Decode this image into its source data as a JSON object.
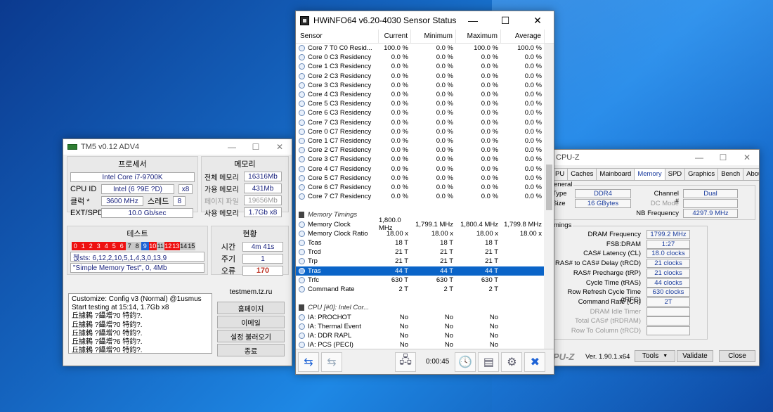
{
  "tm5": {
    "title": "TM5 v0.12 ADV4",
    "cpu_header": "프로세서",
    "cpu_name": "Intel Core i7-9700K",
    "cpu_id_label": "CPU ID",
    "cpu_id_value": "Intel (6 ?9E ?D)",
    "cpu_id_mult": "x8",
    "clock_label": "클럭 *",
    "clock_value": "3600 MHz",
    "threads_label": "스레드",
    "threads_value": "8",
    "ext_label": "EXT/SPD",
    "ext_value": "10.0 Gb/sec",
    "mem_header": "메모리",
    "mem_total_label": "전체 메모리",
    "mem_total_value": "16316Mb",
    "mem_avail_label": "가용 메모리",
    "mem_avail_value": "431Mb",
    "mem_page_label": "페이지 파일",
    "mem_page_value": "19656Mb",
    "mem_used_label": "사용 메모리",
    "mem_used_value": "1.7Gb x8",
    "test_header": "테스트",
    "test_cells": [
      "0",
      "1",
      "2",
      "3",
      "4",
      "5",
      "6",
      "7",
      "8",
      "9",
      "10",
      "11",
      "12",
      "13",
      "14",
      "15"
    ],
    "tests_line": "첹sts: 6,12,2,10,5,1,4,3,0,13,9",
    "config_line": "\"Simple Memory Test\", 0, 4Mb",
    "status_header": "현황",
    "time_label": "시간",
    "time_value": "4m 41s",
    "cycle_label": "주기",
    "cycle_value": "1",
    "error_label": "오류",
    "error_value": "170",
    "log_lines": [
      "Customize: Config v3 (Normal) @1usmus",
      "Start testing at 15:14, 1.7Gb x8",
      "丘據鶫 ?鑷增?0 特鈞?.",
      "丘據鶫 ?鑷增?0 特鈞?.",
      "丘據鶫 ?鑷增?0 特鈞?.",
      "丘據鶫 ?鑷增?6 特鈞?.",
      "丘據鶫 ?鑷增?0 特鈞?."
    ],
    "site": "testmem.tz.ru",
    "btn_home": "홈페이지",
    "btn_email": "이메일",
    "btn_load": "설정 불러오기",
    "btn_exit": "종료"
  },
  "hwinfo": {
    "title": "HWiNFO64 v6.20-4030 Sensor Status",
    "col_sensor": "Sensor",
    "col_current": "Current",
    "col_min": "Minimum",
    "col_max": "Maximum",
    "col_avg": "Average",
    "rows": [
      {
        "name": "Core 7 T0 C0 Resid...",
        "cur": "100.0 %",
        "min": "0.0 %",
        "max": "100.0 %",
        "avg": "100.0 %"
      },
      {
        "name": "Core 0 C3 Residency",
        "cur": "0.0 %",
        "min": "0.0 %",
        "max": "0.0 %",
        "avg": "0.0 %"
      },
      {
        "name": "Core 1 C3 Residency",
        "cur": "0.0 %",
        "min": "0.0 %",
        "max": "0.0 %",
        "avg": "0.0 %"
      },
      {
        "name": "Core 2 C3 Residency",
        "cur": "0.0 %",
        "min": "0.0 %",
        "max": "0.0 %",
        "avg": "0.0 %"
      },
      {
        "name": "Core 3 C3 Residency",
        "cur": "0.0 %",
        "min": "0.0 %",
        "max": "0.0 %",
        "avg": "0.0 %"
      },
      {
        "name": "Core 4 C3 Residency",
        "cur": "0.0 %",
        "min": "0.0 %",
        "max": "0.0 %",
        "avg": "0.0 %"
      },
      {
        "name": "Core 5 C3 Residency",
        "cur": "0.0 %",
        "min": "0.0 %",
        "max": "0.0 %",
        "avg": "0.0 %"
      },
      {
        "name": "Core 6 C3 Residency",
        "cur": "0.0 %",
        "min": "0.0 %",
        "max": "0.0 %",
        "avg": "0.0 %"
      },
      {
        "name": "Core 7 C3 Residency",
        "cur": "0.0 %",
        "min": "0.0 %",
        "max": "0.0 %",
        "avg": "0.0 %"
      },
      {
        "name": "Core 0 C7 Residency",
        "cur": "0.0 %",
        "min": "0.0 %",
        "max": "0.0 %",
        "avg": "0.0 %"
      },
      {
        "name": "Core 1 C7 Residency",
        "cur": "0.0 %",
        "min": "0.0 %",
        "max": "0.0 %",
        "avg": "0.0 %"
      },
      {
        "name": "Core 2 C7 Residency",
        "cur": "0.0 %",
        "min": "0.0 %",
        "max": "0.0 %",
        "avg": "0.0 %"
      },
      {
        "name": "Core 3 C7 Residency",
        "cur": "0.0 %",
        "min": "0.0 %",
        "max": "0.0 %",
        "avg": "0.0 %"
      },
      {
        "name": "Core 4 C7 Residency",
        "cur": "0.0 %",
        "min": "0.0 %",
        "max": "0.0 %",
        "avg": "0.0 %"
      },
      {
        "name": "Core 5 C7 Residency",
        "cur": "0.0 %",
        "min": "0.0 %",
        "max": "0.0 %",
        "avg": "0.0 %"
      },
      {
        "name": "Core 6 C7 Residency",
        "cur": "0.0 %",
        "min": "0.0 %",
        "max": "0.0 %",
        "avg": "0.0 %"
      },
      {
        "name": "Core 7 C7 Residency",
        "cur": "0.0 %",
        "min": "0.0 %",
        "max": "0.0 %",
        "avg": "0.0 %"
      },
      {
        "name": "",
        "cur": "",
        "min": "",
        "max": "",
        "avg": ""
      },
      {
        "name": "Memory Timings",
        "cur": "",
        "min": "",
        "max": "",
        "avg": "",
        "group": true
      },
      {
        "name": "Memory Clock",
        "cur": "1,800.0 MHz",
        "min": "1,799.1 MHz",
        "max": "1,800.4 MHz",
        "avg": "1,799.8 MHz"
      },
      {
        "name": "Memory Clock Ratio",
        "cur": "18.00 x",
        "min": "18.00 x",
        "max": "18.00 x",
        "avg": "18.00 x"
      },
      {
        "name": "Tcas",
        "cur": "18 T",
        "min": "18 T",
        "max": "18 T",
        "avg": ""
      },
      {
        "name": "Trcd",
        "cur": "21 T",
        "min": "21 T",
        "max": "21 T",
        "avg": ""
      },
      {
        "name": "Trp",
        "cur": "21 T",
        "min": "21 T",
        "max": "21 T",
        "avg": ""
      },
      {
        "name": "Tras",
        "cur": "44 T",
        "min": "44 T",
        "max": "44 T",
        "avg": "",
        "selected": true
      },
      {
        "name": "Trfc",
        "cur": "630 T",
        "min": "630 T",
        "max": "630 T",
        "avg": ""
      },
      {
        "name": "Command Rate",
        "cur": "2 T",
        "min": "2 T",
        "max": "2 T",
        "avg": ""
      },
      {
        "name": "",
        "cur": "",
        "min": "",
        "max": "",
        "avg": ""
      },
      {
        "name": "CPU [#0]: Intel Cor...",
        "cur": "",
        "min": "",
        "max": "",
        "avg": "",
        "group": true
      },
      {
        "name": "IA: PROCHOT",
        "cur": "No",
        "min": "No",
        "max": "No",
        "avg": ""
      },
      {
        "name": "IA: Thermal Event",
        "cur": "No",
        "min": "No",
        "max": "No",
        "avg": ""
      },
      {
        "name": "IA: DDR RAPL",
        "cur": "No",
        "min": "No",
        "max": "No",
        "avg": ""
      },
      {
        "name": "IA: PCS (PECI)",
        "cur": "No",
        "min": "No",
        "max": "No",
        "avg": ""
      }
    ],
    "elapsed": "0:00:45"
  },
  "cpuz": {
    "title": "CPU-Z",
    "tabs": [
      "PU",
      "Caches",
      "Mainboard",
      "Memory",
      "SPD",
      "Graphics",
      "Bench",
      "About"
    ],
    "active_tab": "Memory",
    "general_label": "eneral",
    "type_label": "Type",
    "type_value": "DDR4",
    "size_label": "Size",
    "size_value": "16 GBytes",
    "channel_label": "Channel #",
    "channel_value": "Dual",
    "dc_label": "DC Mode",
    "nb_label": "NB Frequency",
    "nb_value": "4297.9 MHz",
    "timings_label": "mings",
    "timing_rows": [
      {
        "label": "DRAM Frequency",
        "value": "1799.2 MHz",
        "dim": false
      },
      {
        "label": "FSB:DRAM",
        "value": "1:27",
        "dim": false
      },
      {
        "label": "CAS# Latency (CL)",
        "value": "18.0 clocks",
        "dim": false
      },
      {
        "label": "RAS# to CAS# Delay (tRCD)",
        "value": "21 clocks",
        "dim": false
      },
      {
        "label": "RAS# Precharge (tRP)",
        "value": "21 clocks",
        "dim": false
      },
      {
        "label": "Cycle Time (tRAS)",
        "value": "44 clocks",
        "dim": false
      },
      {
        "label": "Row Refresh Cycle Time (tRFC)",
        "value": "630 clocks",
        "dim": false
      },
      {
        "label": "Command Rate (CR)",
        "value": "2T",
        "dim": false
      },
      {
        "label": "DRAM Idle Timer",
        "value": "",
        "dim": true
      },
      {
        "label": "Total CAS# (tRDRAM)",
        "value": "",
        "dim": true
      },
      {
        "label": "Row To Column (tRCD)",
        "value": "",
        "dim": true
      }
    ],
    "brand": "PU-Z",
    "version": "Ver. 1.90.1.x64",
    "btn_tools": "Tools",
    "btn_validate": "Validate",
    "btn_close": "Close"
  }
}
